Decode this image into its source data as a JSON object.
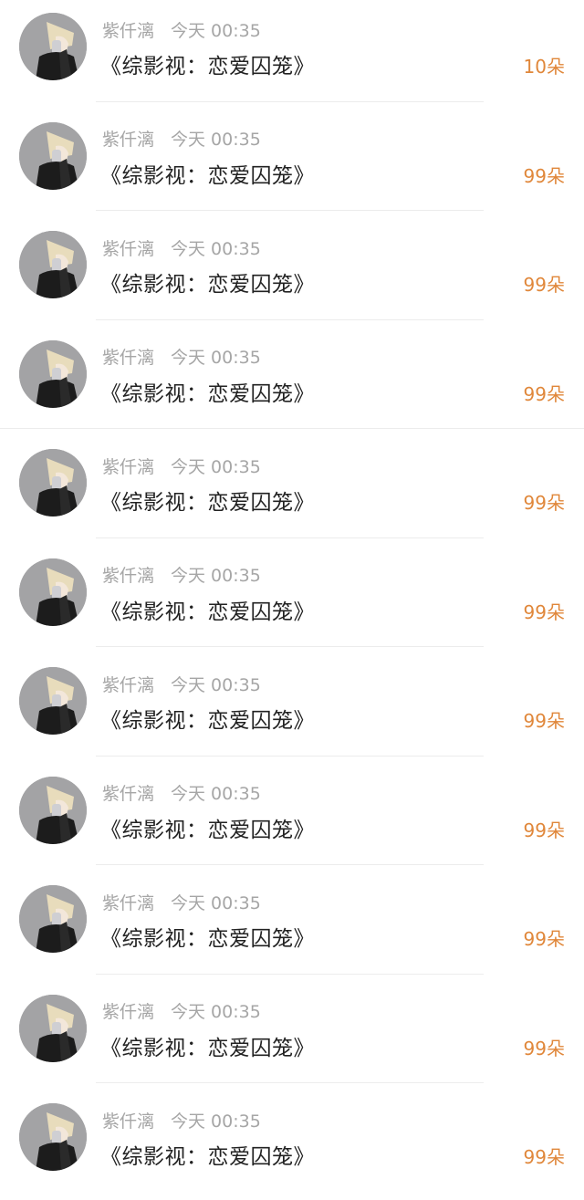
{
  "items": [
    {
      "user": "紫仟漓",
      "time": "今天 00:35",
      "title": "《综影视：恋爱囚笼》",
      "amount": "10朵"
    },
    {
      "user": "紫仟漓",
      "time": "今天 00:35",
      "title": "《综影视：恋爱囚笼》",
      "amount": "99朵"
    },
    {
      "user": "紫仟漓",
      "time": "今天 00:35",
      "title": "《综影视：恋爱囚笼》",
      "amount": "99朵"
    },
    {
      "user": "紫仟漓",
      "time": "今天 00:35",
      "title": "《综影视：恋爱囚笼》",
      "amount": "99朵"
    },
    {
      "user": "紫仟漓",
      "time": "今天 00:35",
      "title": "《综影视：恋爱囚笼》",
      "amount": "99朵"
    },
    {
      "user": "紫仟漓",
      "time": "今天 00:35",
      "title": "《综影视：恋爱囚笼》",
      "amount": "99朵"
    },
    {
      "user": "紫仟漓",
      "time": "今天 00:35",
      "title": "《综影视：恋爱囚笼》",
      "amount": "99朵"
    },
    {
      "user": "紫仟漓",
      "time": "今天 00:35",
      "title": "《综影视：恋爱囚笼》",
      "amount": "99朵"
    },
    {
      "user": "紫仟漓",
      "time": "今天 00:35",
      "title": "《综影视：恋爱囚笼》",
      "amount": "99朵"
    },
    {
      "user": "紫仟漓",
      "time": "今天 00:35",
      "title": "《综影视：恋爱囚笼》",
      "amount": "99朵"
    },
    {
      "user": "紫仟漓",
      "time": "今天 00:35",
      "title": "《综影视：恋爱囚笼》",
      "amount": "99朵"
    }
  ],
  "colors": {
    "amount": "#e0873a",
    "meta": "#a6a6a6",
    "title": "#222222"
  },
  "icons": {
    "avatar": "user-avatar-photo"
  }
}
